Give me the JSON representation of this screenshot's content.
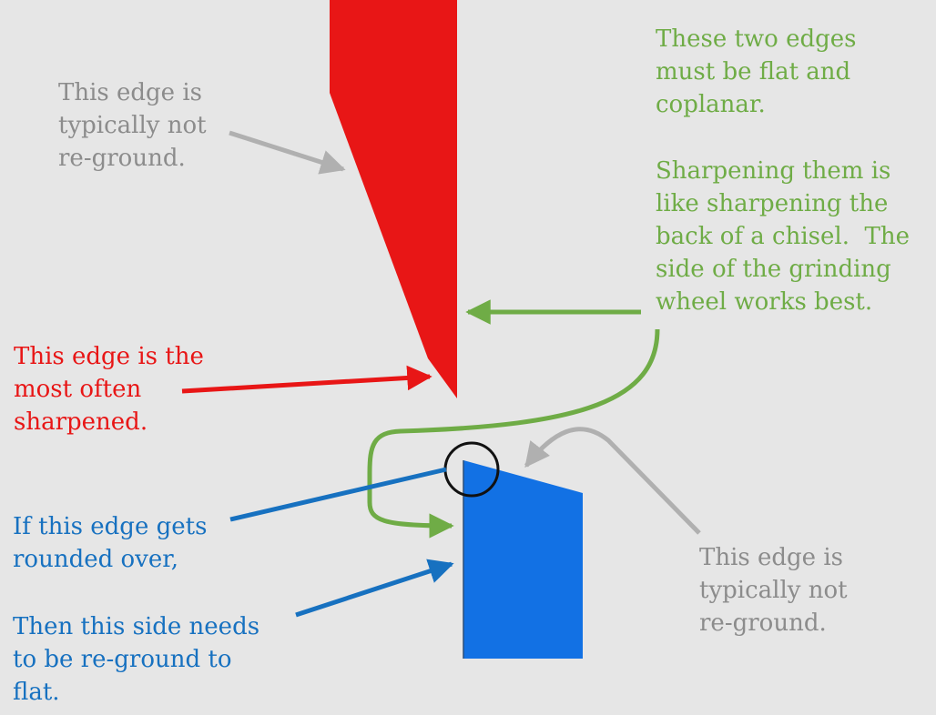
{
  "colors": {
    "background": "#e6e6e6",
    "gray": "#8c8c8c",
    "gray_arrow": "#b0b0b0",
    "green": "#6fac46",
    "red": "#e81616",
    "blue": "#1771c0",
    "blue_shape": "#1271e4",
    "circle": "#111111"
  },
  "labels": {
    "top_left": [
      "This edge is",
      "typically not",
      "re-ground."
    ],
    "green_top": [
      "These two edges",
      "must be flat and",
      "coplanar."
    ],
    "green_bottom": [
      "Sharpening them is",
      "like sharpening the",
      "back of a chisel.  The",
      "side of the grinding",
      "wheel works best."
    ],
    "red": [
      "This edge is the",
      "most often",
      "sharpened."
    ],
    "blue_top": [
      "If this edge gets",
      "rounded over,"
    ],
    "blue_bottom": [
      "Then this side needs",
      "to be re-ground to",
      "flat."
    ],
    "bottom_right": [
      "This edge is",
      "typically not",
      "re-ground."
    ]
  },
  "shapes": {
    "red_blade": "red-blade",
    "blue_block": "blue-block",
    "corner_marker": "circle-marker"
  }
}
